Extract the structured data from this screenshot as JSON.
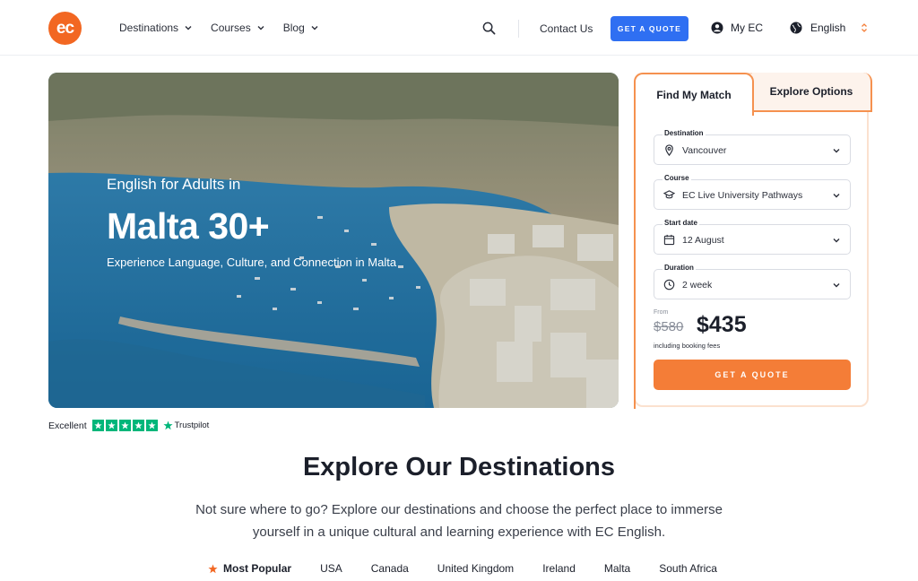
{
  "header": {
    "logo_text": "ec",
    "nav": [
      {
        "label": "Destinations"
      },
      {
        "label": "Courses"
      },
      {
        "label": "Blog"
      }
    ],
    "contact_label": "Contact Us",
    "quote_label": "GET A QUOTE",
    "account_label": "My EC",
    "language_label": "English"
  },
  "hero": {
    "subtitle": "English for Adults in",
    "title": "Malta 30+",
    "tagline": "Experience Language, Culture, and Connection in Malta"
  },
  "trustpilot": {
    "rating_text": "Excellent",
    "brand": "Trustpilot",
    "stars": 5
  },
  "match_card": {
    "tab_active": "Find My Match",
    "tab_inactive": "Explore Options",
    "fields": [
      {
        "label": "Destination",
        "value": "Vancouver",
        "icon": "location-pin-icon"
      },
      {
        "label": "Course",
        "value": "EC Live University Pathways",
        "icon": "graduation-cap-icon"
      },
      {
        "label": "Start date",
        "value": "12 August",
        "icon": "calendar-icon"
      },
      {
        "label": "Duration",
        "value": "2 week",
        "icon": "clock-icon"
      }
    ],
    "from_label": "From",
    "old_price": "$580",
    "new_price": "$435",
    "fees_note": "including booking fees",
    "quote_label": "GET A QUOTE"
  },
  "explore": {
    "title": "Explore Our Destinations",
    "description": "Not sure where to go? Explore our destinations and choose the perfect place to immerse yourself in a unique cultural and learning experience with EC English.",
    "tabs": [
      "Most Popular",
      "USA",
      "Canada",
      "United Kingdom",
      "Ireland",
      "Malta",
      "South Africa"
    ]
  },
  "colors": {
    "brand_orange": "#f26722",
    "primary_blue": "#2f6ff2",
    "cta_orange": "#f47d37",
    "trustpilot_green": "#00b67a"
  }
}
